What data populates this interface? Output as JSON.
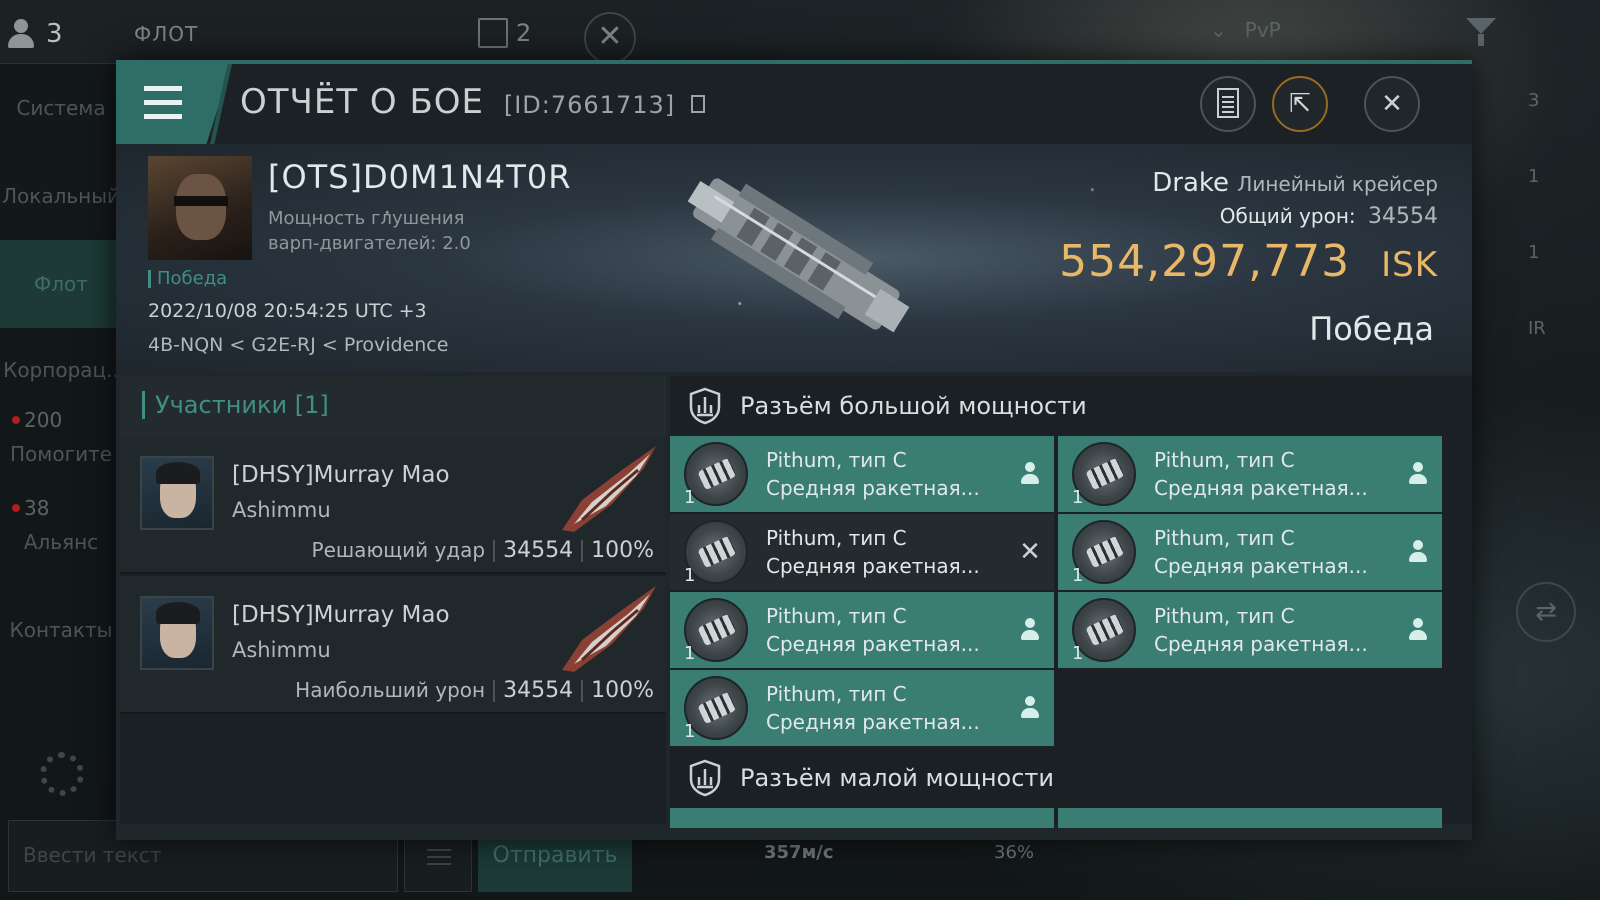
{
  "chat": {
    "pilot_count": "3",
    "fleet_label": "ФЛОТ",
    "fleet_windows": "2",
    "nav": [
      "Система",
      "Локальный",
      "Флот",
      "Корпорац..",
      "Помогите",
      "Альянс",
      "Контакты"
    ],
    "help_count": "200",
    "alliance_count": "38",
    "input_placeholder": "Ввести текст",
    "send_label": "Отправить"
  },
  "hud": {
    "filter_label": "PvP",
    "speed": "357м/с",
    "capacitor_pct": "36%",
    "right_rail": [
      "3",
      "1",
      "1",
      "IR"
    ]
  },
  "report": {
    "title": "ОТЧЁТ О БОЕ",
    "report_id": "[ID:7661713]",
    "pilot": {
      "name": "[OTS]D0M1N4T0R",
      "stat_line1": "Мощность глушения",
      "stat_line2": "варп-двигателей: 2.0",
      "result_tag": "Победа",
      "datetime": "2022/10/08 20:54:25 UTC +3",
      "location": "4B-NQN < G2E-RJ < Providence"
    },
    "ship": {
      "name": "Drake",
      "class": "Линейный крейсер",
      "damage_label": "Общий урон:",
      "damage_value": "34554",
      "isk_value": "554,297,773",
      "isk_unit": "ISK",
      "outcome": "Победа"
    },
    "participants_label": "Участники [1]",
    "participants": [
      {
        "name": "[DHSY]Murray Mao",
        "ship": "Ashimmu",
        "role": "Решающий удар",
        "damage": "34554",
        "pct": "100%"
      },
      {
        "name": "[DHSY]Murray Mao",
        "ship": "Ashimmu",
        "role": "Наибольший урон",
        "damage": "34554",
        "pct": "100%"
      }
    ],
    "high_slot_label": "Разъём большой мощности",
    "low_slot_label": "Разъём малой мощности",
    "modules": [
      {
        "name": "Pithum, тип C",
        "sub": "Средняя ракетная...",
        "qty": "1",
        "status": "dropped"
      },
      {
        "name": "Pithum, тип C",
        "sub": "Средняя ракетная...",
        "qty": "1",
        "status": "dropped"
      },
      {
        "name": "Pithum, тип C",
        "sub": "Средняя ракетная...",
        "qty": "1",
        "status": "destroyed"
      },
      {
        "name": "Pithum, тип C",
        "sub": "Средняя ракетная...",
        "qty": "1",
        "status": "dropped"
      },
      {
        "name": "Pithum, тип C",
        "sub": "Средняя ракетная...",
        "qty": "1",
        "status": "dropped"
      },
      {
        "name": "Pithum, тип C",
        "sub": "Средняя ракетная...",
        "qty": "1",
        "status": "dropped"
      },
      {
        "name": "Pithum, тип C",
        "sub": "Средняя ракетная...",
        "qty": "1",
        "status": "dropped"
      }
    ],
    "colors": {
      "accent": "#3a7d73",
      "isk": "#e8b867",
      "victory": "#3f8f84"
    }
  }
}
